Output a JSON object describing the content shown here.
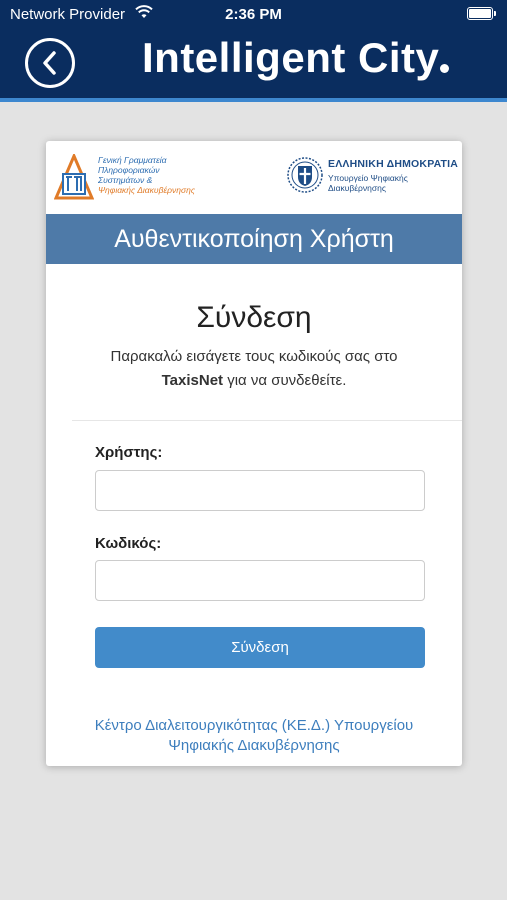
{
  "status_bar": {
    "carrier": "Network Provider",
    "time": "2:36 PM"
  },
  "header": {
    "title": "Intelligent City",
    "background_color": "#0a2d5f",
    "accent_color": "#3d87cf",
    "back_icon": "chevron-left-icon"
  },
  "logos": {
    "gsis": {
      "lines": [
        "Γενική Γραμματεία",
        "Πληροφοριακών",
        "Συστημάτων &",
        "Ψηφιακής Διακυβέρνησης"
      ],
      "mark": "ΓΓΠΣ"
    },
    "gov": {
      "title": "ΕΛΛΗΝΙΚΗ ΔΗΜΟΚΡΑΤΙΑ",
      "subtitle_1": "Υπουργείο Ψηφιακής",
      "subtitle_2": "Διακυβέρνησης"
    }
  },
  "auth_banner": {
    "text": "Αυθεντικοποίηση Χρήστη",
    "color": "#4e7aa8"
  },
  "login": {
    "heading": "Σύνδεση",
    "desc_part1": "Παρακαλώ εισάγετε τους κωδικούς σας στο",
    "desc_bold": "TaxisNet",
    "desc_part2": " για να συνδεθείτε.",
    "username_label": "Χρήστης:",
    "username_value": "",
    "password_label": "Κωδικός:",
    "password_value": "",
    "submit_label": "Σύνδεση",
    "button_color": "#428bca"
  },
  "footer": {
    "line1": "Κέντρο Διαλειτουργικότητας (ΚΕ.Δ.) Υπουργείου",
    "line2": "Ψηφιακής Διακυβέρνησης"
  }
}
